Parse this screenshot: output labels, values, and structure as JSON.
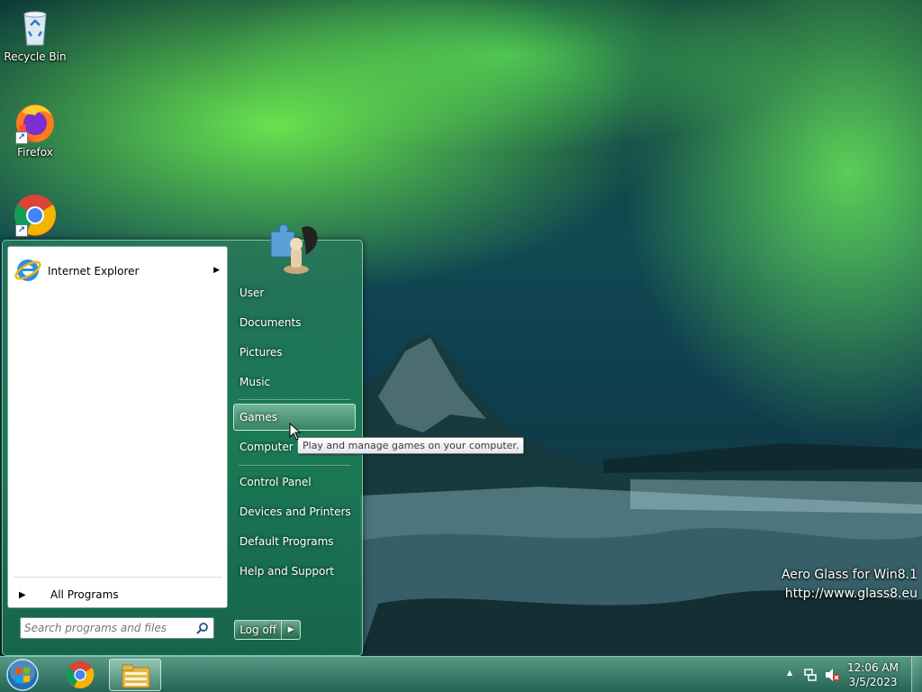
{
  "desktop": {
    "icons": [
      {
        "label": "Recycle Bin"
      },
      {
        "label": "Firefox"
      },
      {
        "label": ""
      }
    ],
    "watermark": {
      "line1": "Aero Glass for Win8.1",
      "line2": "http://www.glass8.eu"
    }
  },
  "start_menu": {
    "pinned": [
      {
        "label": "Internet Explorer",
        "has_submenu": true
      }
    ],
    "all_programs_label": "All Programs",
    "search": {
      "placeholder": "Search programs and files",
      "value": ""
    },
    "right_items": [
      {
        "label": "User"
      },
      {
        "label": "Documents"
      },
      {
        "label": "Pictures"
      },
      {
        "label": "Music"
      },
      {
        "label": "Games"
      },
      {
        "label": "Computer"
      },
      {
        "label": "Control Panel"
      },
      {
        "label": "Devices and Printers"
      },
      {
        "label": "Default Programs"
      },
      {
        "label": "Help and Support"
      }
    ],
    "hovered_item": "Games",
    "logoff_label": "Log off",
    "tooltip": "Play and manage games on your computer."
  },
  "taskbar": {
    "pinned_apps": [
      "chrome-icon",
      "file-explorer-icon"
    ],
    "clock": {
      "time": "12:06 AM",
      "date": "3/5/2023"
    }
  },
  "colors": {
    "start_menu_glass": "#1e8c5a",
    "accent": "#1c5fb8"
  }
}
